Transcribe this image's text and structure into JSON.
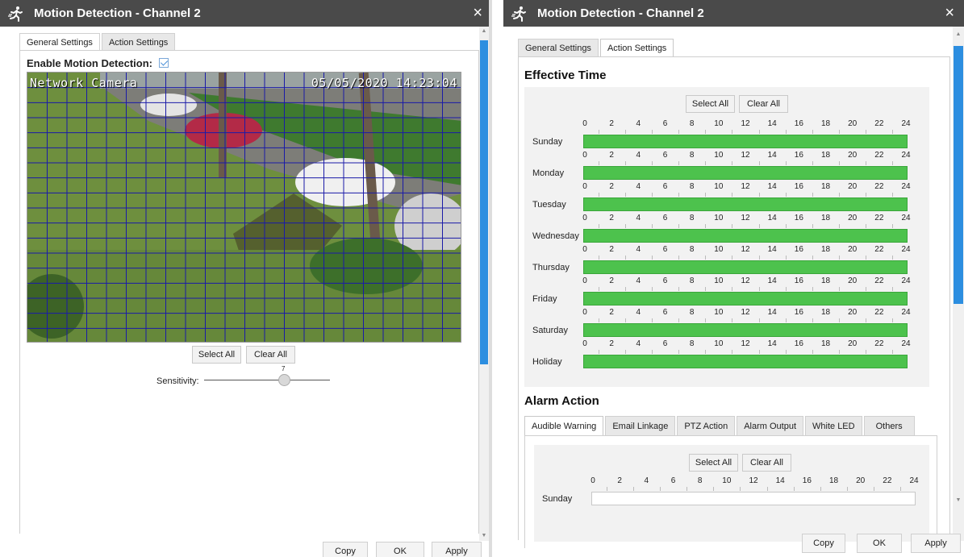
{
  "left_dialog": {
    "title": "Motion Detection - Channel 2",
    "close_glyph": "×",
    "tabs": [
      {
        "label": "General Settings",
        "active": true
      },
      {
        "label": "Action Settings",
        "active": false
      }
    ],
    "enable_label": "Enable Motion Detection:",
    "enable_checked": true,
    "camera_osd": {
      "name": "Network Camera",
      "datetime": "05/05/2020 14:23:04"
    },
    "select_all": "Select All",
    "clear_all": "Clear All",
    "sensitivity_label": "Sensitivity:",
    "sensitivity_value": "7",
    "footer": {
      "copy": "Copy",
      "ok": "OK",
      "apply": "Apply"
    }
  },
  "right_dialog": {
    "title": "Motion Detection - Channel 2",
    "close_glyph": "×",
    "tabs": [
      {
        "label": "General Settings",
        "active": false
      },
      {
        "label": "Action Settings",
        "active": true
      }
    ],
    "effective_time": {
      "title": "Effective Time",
      "select_all": "Select All",
      "clear_all": "Clear All",
      "hours": [
        "0",
        "2",
        "4",
        "6",
        "8",
        "10",
        "12",
        "14",
        "16",
        "18",
        "20",
        "22",
        "24"
      ],
      "days": [
        "Sunday",
        "Monday",
        "Tuesday",
        "Wednesday",
        "Thursday",
        "Friday",
        "Saturday",
        "Holiday"
      ],
      "all_day_enabled": true
    },
    "alarm_action": {
      "title": "Alarm Action",
      "tabs": [
        {
          "label": "Audible Warning",
          "active": true
        },
        {
          "label": "Email Linkage",
          "active": false
        },
        {
          "label": "PTZ Action",
          "active": false
        },
        {
          "label": "Alarm Output",
          "active": false
        },
        {
          "label": "White LED",
          "active": false
        },
        {
          "label": "Others",
          "active": false
        }
      ],
      "select_all": "Select All",
      "clear_all": "Clear All",
      "days": [
        "Sunday"
      ],
      "enabled": false
    },
    "footer": {
      "copy": "Copy",
      "ok": "OK",
      "apply": "Apply"
    }
  },
  "colors": {
    "titlebar": "#4a4a4a",
    "schedule_active": "#4dc24d",
    "grid_line": "#1a1aa8",
    "scroll_thumb": "#2c8ee0"
  },
  "icons": [
    "motion-detection-icon",
    "close-icon",
    "checkbox-icon"
  ]
}
